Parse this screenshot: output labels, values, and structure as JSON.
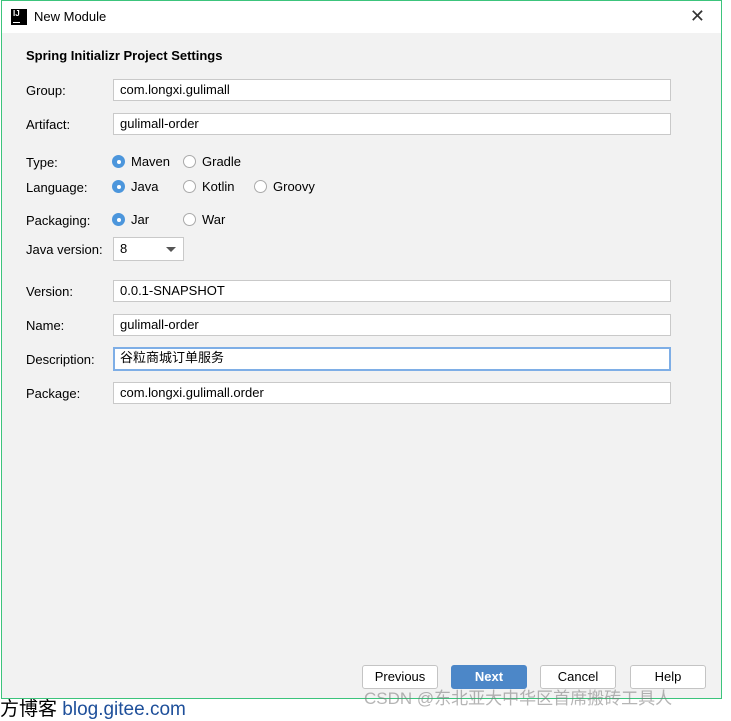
{
  "window": {
    "title": "New Module",
    "app_icon": "intellij-icon",
    "close_icon": "close-icon"
  },
  "section_title": "Spring Initializr Project Settings",
  "fields": {
    "group": {
      "label": "Group:",
      "value": "com.longxi.gulimall"
    },
    "artifact": {
      "label": "Artifact:",
      "value": "gulimall-order"
    },
    "version": {
      "label": "Version:",
      "value": "0.0.1-SNAPSHOT"
    },
    "name": {
      "label": "Name:",
      "value": "gulimall-order"
    },
    "description": {
      "label": "Description:",
      "value": "谷粒商城订单服务"
    },
    "package": {
      "label": "Package:",
      "value": "com.longxi.gulimall.order"
    }
  },
  "type": {
    "label": "Type:",
    "options": [
      "Maven",
      "Gradle"
    ],
    "selected": "Maven"
  },
  "language": {
    "label": "Language:",
    "options": [
      "Java",
      "Kotlin",
      "Groovy"
    ],
    "selected": "Java"
  },
  "packaging": {
    "label": "Packaging:",
    "options": [
      "Jar",
      "War"
    ],
    "selected": "Jar"
  },
  "java_version": {
    "label": "Java version:",
    "value": "8"
  },
  "buttons": {
    "previous": "Previous",
    "next": "Next",
    "cancel": "Cancel",
    "help": "Help"
  },
  "colors": {
    "accent": "#4c87c8",
    "radio": "#4c96dc",
    "border": "#3cc47c"
  },
  "watermark": "CSDN @东北亚大中华区首席搬砖工具人",
  "background": {
    "prefix": "方博客 ",
    "link": "blog.gitee.com"
  }
}
